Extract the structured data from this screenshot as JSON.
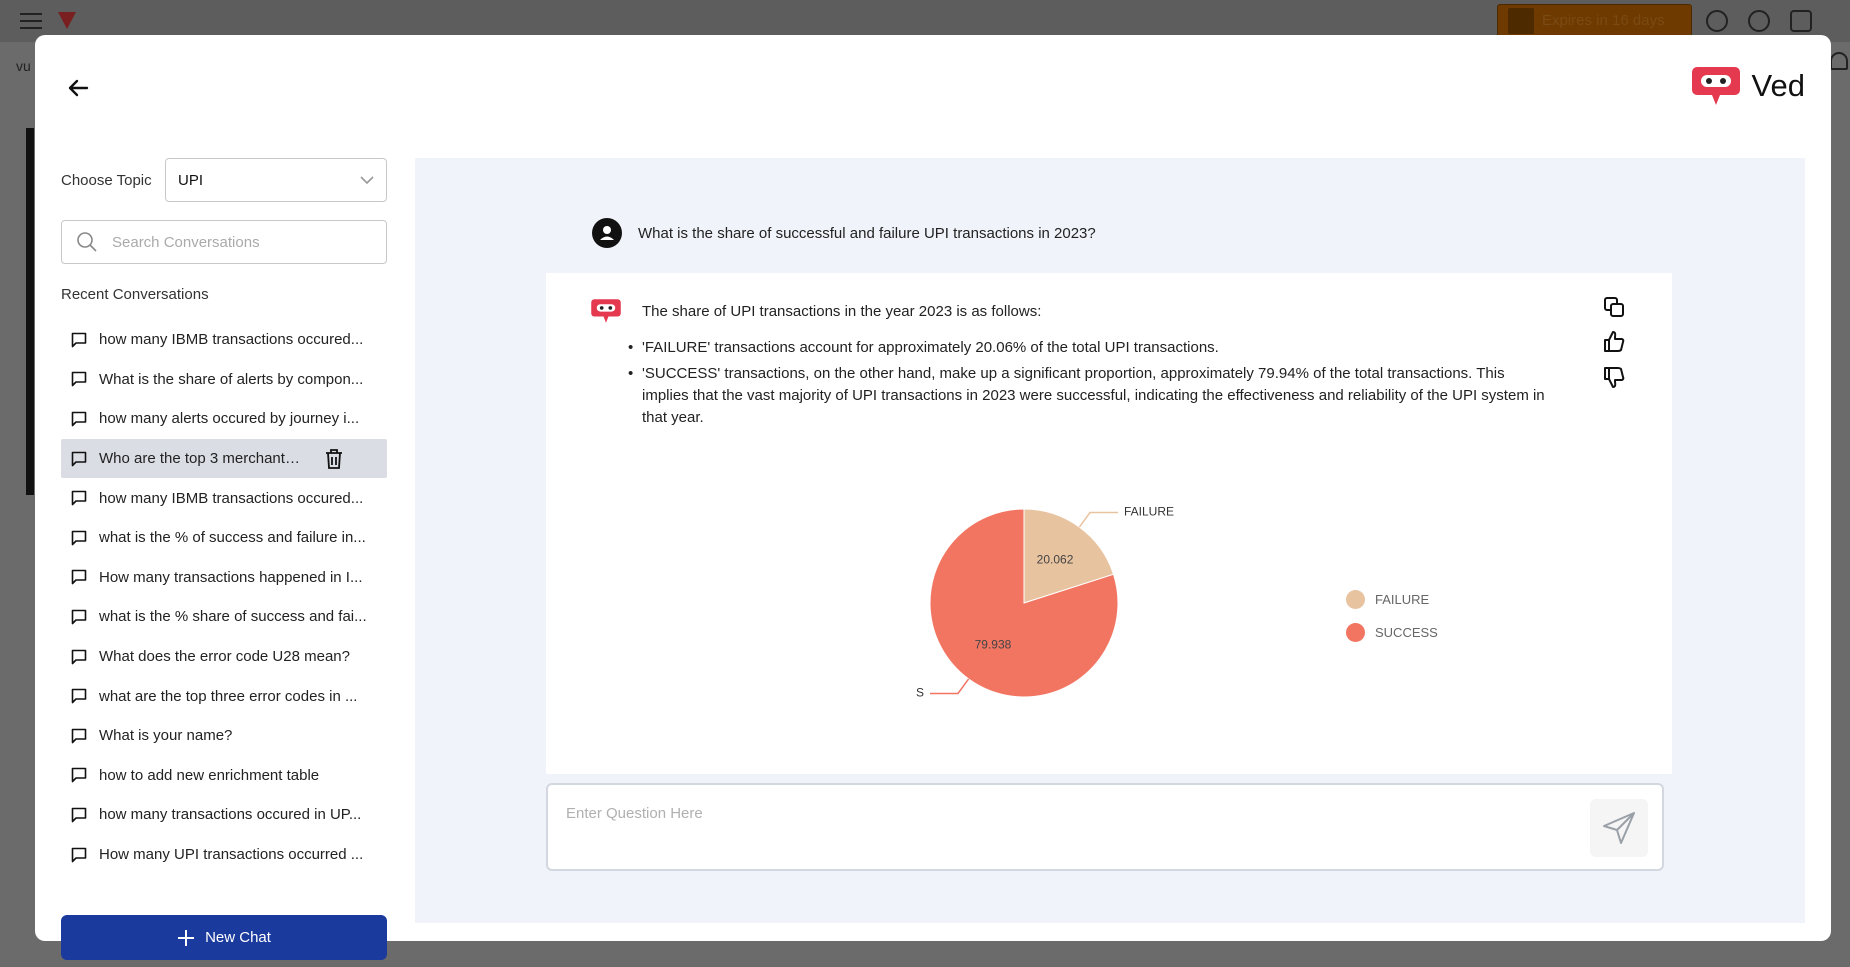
{
  "background": {
    "vu_text": "vu",
    "expires_text": "Expires in 16 days"
  },
  "header": {
    "brand_name": "Ved",
    "brand_color": "#e53950"
  },
  "sidebar": {
    "topic_label": "Choose Topic",
    "topic_value": "UPI",
    "search_placeholder": "Search Conversations",
    "recent_title": "Recent Conversations",
    "conversations": [
      "how many IBMB transactions occured...",
      "What is the share of alerts by compon...",
      "how many alerts occured by journey i...",
      "Who are the top 3 merchants wit...",
      "how many IBMB transactions occured...",
      "what is the % of success and failure in...",
      "How many transactions happened in I...",
      "what is the % share of success and fai...",
      "What does the error code U28 mean?",
      "what are the top three error codes in ...",
      "What is your name?",
      "how to add new enrichment table",
      "how many transactions occured in UP...",
      "How many UPI transactions occurred ..."
    ],
    "active_index": 3,
    "new_chat_label": "New Chat",
    "new_chat_color": "#1a3a9d"
  },
  "chat": {
    "question": "What is the share of successful and failure UPI transactions in 2023?",
    "answer_intro": "The share of UPI transactions in the year 2023 is as follows:",
    "answer_bullets": [
      "'FAILURE' transactions account for approximately 20.06% of the total UPI transactions.",
      "'SUCCESS' transactions, on the other hand, make up a significant proportion, approximately 79.94% of the total transactions. This implies that the vast majority of UPI transactions in 2023 were successful, indicating the effectiveness and reliability of the UPI system in that year."
    ],
    "input_placeholder": "Enter Question Here"
  },
  "chart_data": {
    "type": "pie",
    "categories": [
      "FAILURE",
      "SUCCESS"
    ],
    "values": [
      20.062,
      79.938
    ],
    "colors": [
      "#e8c3a0",
      "#f27562"
    ],
    "legend_position": "right"
  }
}
